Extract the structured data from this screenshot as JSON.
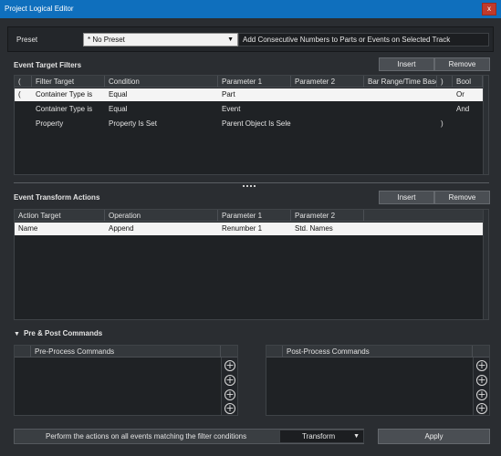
{
  "window": {
    "title": "Project Logical Editor",
    "close_label": "x"
  },
  "preset": {
    "label": "Preset",
    "value": "* No Preset",
    "dropdown_icon": "▼",
    "description": "Add Consecutive Numbers to Parts or Events on Selected Track"
  },
  "filters": {
    "title": "Event Target Filters",
    "insert_label": "Insert",
    "remove_label": "Remove",
    "columns": [
      "(",
      "Filter Target",
      "Condition",
      "Parameter 1",
      "Parameter 2",
      "Bar Range/Time Base",
      ")",
      "Bool"
    ],
    "rows": [
      [
        "(",
        "Container Type is",
        "Equal",
        "Part",
        "",
        "",
        "",
        "Or"
      ],
      [
        "",
        "Container Type is",
        "Equal",
        "Event",
        "",
        "",
        "",
        "And"
      ],
      [
        "",
        "Property",
        "Property Is Set",
        "Parent Object Is Selec",
        "",
        "",
        ")",
        ""
      ]
    ]
  },
  "actions": {
    "title": "Event Transform Actions",
    "insert_label": "Insert",
    "remove_label": "Remove",
    "columns": [
      "Action Target",
      "Operation",
      "Parameter 1",
      "Parameter 2",
      ""
    ],
    "rows": [
      [
        "Name",
        "Append",
        "Renumber 1",
        "Std. Names",
        ""
      ]
    ]
  },
  "commands": {
    "title": "Pre & Post Commands",
    "toggle_icon": "▼",
    "pre_header": "Pre-Process Commands",
    "post_header": "Post-Process Commands",
    "add_icon_glyph": "+"
  },
  "footer": {
    "perform_text": "Perform the actions on all events matching the filter conditions",
    "mode_value": "Transform",
    "mode_icon": "▼",
    "apply_label": "Apply"
  }
}
